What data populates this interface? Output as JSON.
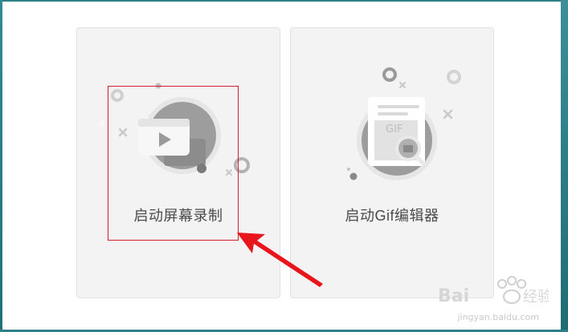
{
  "cards": {
    "screen_record": {
      "label": "启动屏幕录制",
      "icon": "video-play-icon"
    },
    "gif_editor": {
      "label": "启动Gif编辑器",
      "icon": "gif-document-search-icon"
    }
  },
  "annotation": {
    "highlight_color": "#d0202a",
    "arrow_color": "#e8161c"
  },
  "watermark": {
    "brand": "Baidu经验",
    "url": "jingyan.baidu.com"
  },
  "colors": {
    "card_bg": "#f3f3f3",
    "icon_circle": "#9a9a9a",
    "frame": "#2f7f88"
  }
}
